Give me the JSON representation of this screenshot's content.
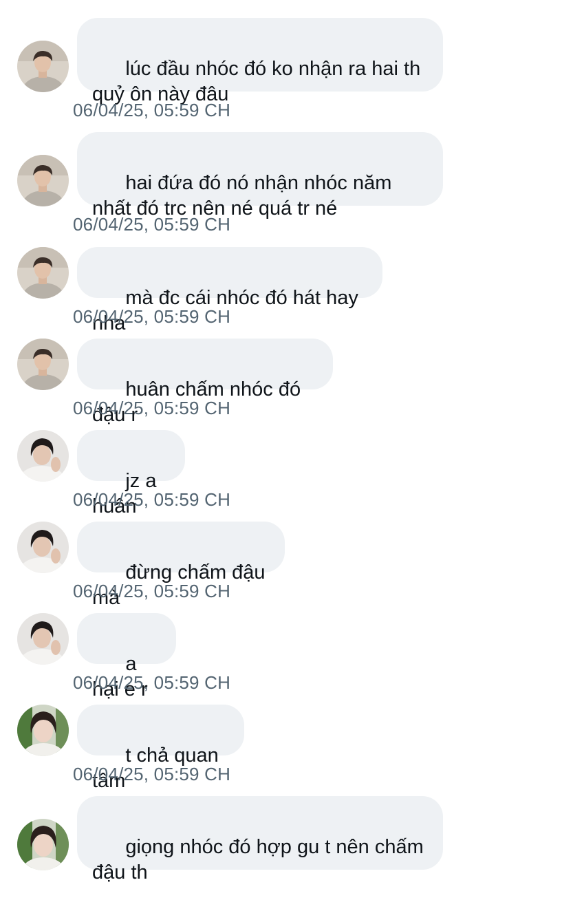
{
  "conversation": {
    "messages": [
      {
        "text": "lúc đầu nhóc đó ko nhận ra hai th quỷ ôn này đâu",
        "time": "06/04/25, 05:59 CH",
        "avatar": "avatar-user-a-icon"
      },
      {
        "text": "hai đứa đó nó nhận nhóc năm nhất đó trc nên né quá tr né",
        "time": "06/04/25, 05:59 CH",
        "avatar": "avatar-user-a-icon"
      },
      {
        "text": "mà đc cái nhóc đó hát hay nha",
        "time": "06/04/25, 05:59 CH",
        "avatar": "avatar-user-a-icon"
      },
      {
        "text": "huân chấm nhóc đó đậu r",
        "time": "06/04/25, 05:59 CH",
        "avatar": "avatar-user-a-icon"
      },
      {
        "text": "jz a huân",
        "time": "06/04/25, 05:59 CH",
        "avatar": "avatar-user-b-icon"
      },
      {
        "text": "đừng chấm đậu mà",
        "time": "06/04/25, 05:59 CH",
        "avatar": "avatar-user-b-icon"
      },
      {
        "text": "a hại e r",
        "time": "06/04/25, 05:59 CH",
        "avatar": "avatar-user-b-icon"
      },
      {
        "text": "t chả quan tâm",
        "time": "06/04/25, 05:59 CH",
        "avatar": "avatar-user-c-icon"
      },
      {
        "text": "giọng nhóc đó hợp gu t nên chấm đậu th",
        "time": "",
        "avatar": "avatar-user-c-icon"
      }
    ]
  },
  "colors": {
    "bubble": "#eef1f4",
    "text": "#0f1419",
    "timestamp": "#536471"
  }
}
